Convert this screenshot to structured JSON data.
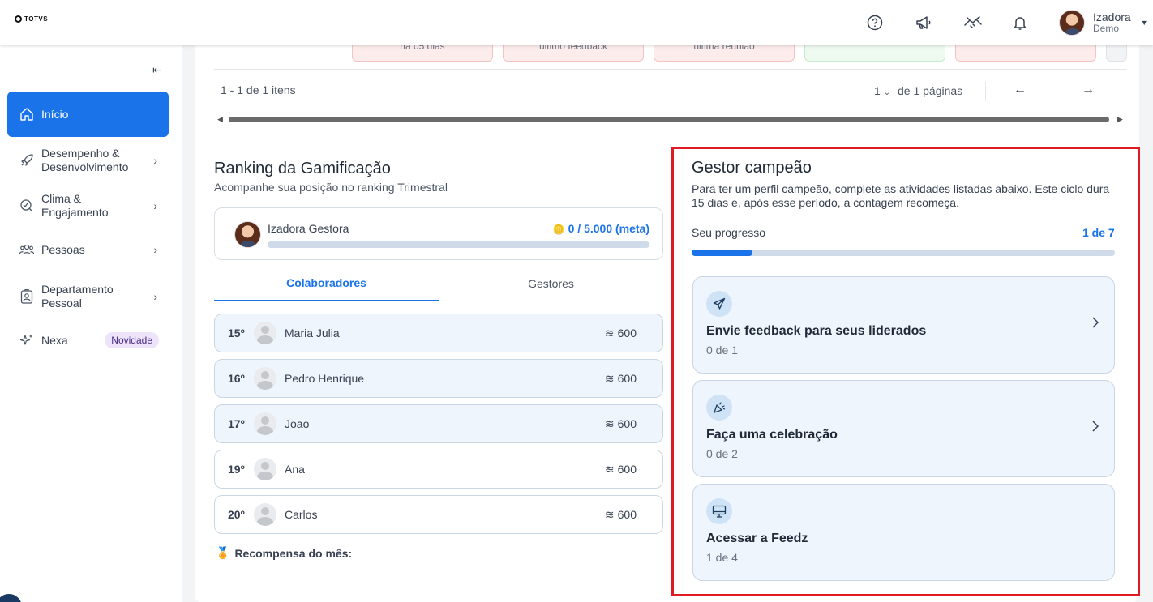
{
  "header": {
    "logo": "TOTVS",
    "user_name": "Izadora",
    "user_role": "Demo",
    "icons": [
      "help-icon",
      "megaphone-icon",
      "handshake-icon",
      "bell-icon"
    ]
  },
  "sidebar": {
    "items": [
      {
        "label": "Início",
        "icon": "home-icon"
      },
      {
        "label": "Desempenho &\nDesenvolvimento",
        "icon": "rocket-icon"
      },
      {
        "label": "Clima &\nEngajamento",
        "icon": "climate-icon"
      },
      {
        "label": "Pessoas",
        "icon": "people-icon"
      },
      {
        "label": "Departamento\nPessoal",
        "icon": "badge-icon"
      },
      {
        "label": "Nexa",
        "icon": "sparkle-icon",
        "badge": "Novidade"
      }
    ]
  },
  "table_strip": {
    "cells": [
      "há 05 dias",
      "último feedback",
      "última reunião",
      "",
      ""
    ]
  },
  "pagination": {
    "items_text": "1 - 1 de 1 itens",
    "page_value": "1",
    "pages_text": "de 1 páginas"
  },
  "ranking": {
    "title": "Ranking da Gamificação",
    "subtitle": "Acompanhe sua posição no ranking Trimestral",
    "me": {
      "name": "Izadora Gestora",
      "points": "0 / 5.000 (meta)",
      "progress": 0
    },
    "tabs": [
      "Colaboradores",
      "Gestores"
    ],
    "rows": [
      {
        "pos": "15º",
        "name": "Maria Julia",
        "points": "600"
      },
      {
        "pos": "16º",
        "name": "Pedro Henrique",
        "points": "600"
      },
      {
        "pos": "17º",
        "name": "Joao",
        "points": "600"
      },
      {
        "pos": "19º",
        "name": "Ana",
        "points": "600"
      },
      {
        "pos": "20º",
        "name": "Carlos",
        "points": "600"
      }
    ],
    "reward_label": "Recompensa do mês:"
  },
  "gestor": {
    "title": "Gestor campeão",
    "description": "Para ter um perfil campeão, complete as atividades listadas abaixo. Este ciclo dura 15 dias e, após esse período, a contagem recomeça.",
    "progress_label": "Seu progresso",
    "progress_value": "1 de 7",
    "progress_fraction": 0.143,
    "tasks": [
      {
        "title": "Envie feedback para seus liderados",
        "status": "0 de 1",
        "icon": "send-icon"
      },
      {
        "title": "Faça uma celebração",
        "status": "0 de 2",
        "icon": "party-icon"
      },
      {
        "title": "Acessar a Feedz",
        "status": "1 de 4",
        "icon": "monitor-icon"
      }
    ]
  },
  "colors": {
    "accent": "#1a73e8",
    "highlight": "#e01b24"
  }
}
